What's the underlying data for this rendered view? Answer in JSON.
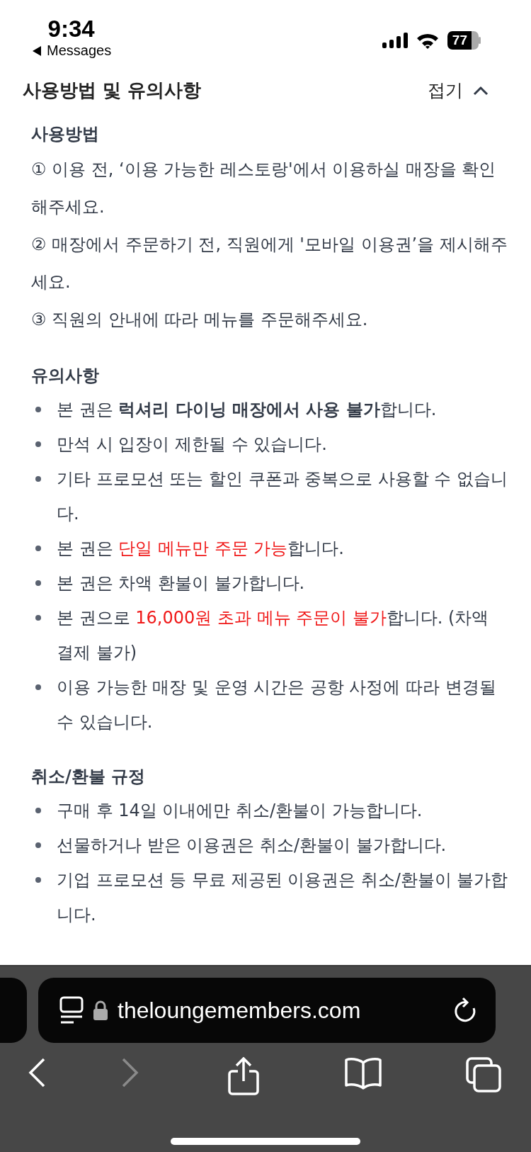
{
  "status_bar": {
    "time": "9:34",
    "back_label": "Messages",
    "battery": "77"
  },
  "header": {
    "title": "사용방법 및 유의사항",
    "toggle_label": "접기",
    "expanded": true
  },
  "sections": [
    {
      "title": "사용방법",
      "kind": "numbered",
      "items": [
        [
          {
            "text": "① 이용 전, ‘이용 가능한 레스토랑'에서 이용하실 매장을 확인해주세요.",
            "kind": "plain"
          }
        ],
        [
          {
            "text": "② 매장에서 주문하기 전, 직원에게 '모바일 이용권’을 제시해주세요.",
            "kind": "plain"
          }
        ],
        [
          {
            "text": "③ 직원의 안내에 따라 메뉴를 주문해주세요.",
            "kind": "plain"
          }
        ]
      ]
    },
    {
      "title": "유의사항",
      "kind": "bullets",
      "items": [
        [
          {
            "text": "본 권은 ",
            "kind": "plain"
          },
          {
            "text": "럭셔리 다이닝 매장에서 사용 불가",
            "kind": "bold"
          },
          {
            "text": "합니다.",
            "kind": "plain"
          }
        ],
        [
          {
            "text": "만석 시 입장이 제한될 수 있습니다.",
            "kind": "plain"
          }
        ],
        [
          {
            "text": "기타 프로모션 또는 할인 쿠폰과 중복으로 사용할 수 없습니다.",
            "kind": "plain"
          }
        ],
        [
          {
            "text": "본 권은 ",
            "kind": "plain"
          },
          {
            "text": "단일 메뉴만 주문 가능",
            "kind": "red"
          },
          {
            "text": "합니다.",
            "kind": "plain"
          }
        ],
        [
          {
            "text": "본 권은 차액 환불이 불가합니다.",
            "kind": "plain"
          }
        ],
        [
          {
            "text": "본 권으로 ",
            "kind": "plain"
          },
          {
            "text": "16,000원 초과 메뉴 주문이 불가",
            "kind": "red"
          },
          {
            "text": "합니다. (차액 결제 불가)",
            "kind": "plain"
          }
        ],
        [
          {
            "text": "이용 가능한 매장 및 운영 시간은 공항 사정에 따라 변경될 수 있습니다.",
            "kind": "plain"
          }
        ]
      ]
    },
    {
      "title": "취소/환불 규정",
      "kind": "bullets",
      "items": [
        [
          {
            "text": "구매 후 14일 이내에만 취소/환불이 가능합니다.",
            "kind": "plain"
          }
        ],
        [
          {
            "text": "선물하거나 받은 이용권은 취소/환불이 불가합니다.",
            "kind": "plain"
          }
        ],
        [
          {
            "text": "기업 프로모션 등 무료 제공된 이용권은 취소/환불이 불가합니다.",
            "kind": "plain"
          }
        ]
      ]
    }
  ],
  "browser": {
    "url": "theloungemembers.com",
    "forward_enabled": false
  }
}
